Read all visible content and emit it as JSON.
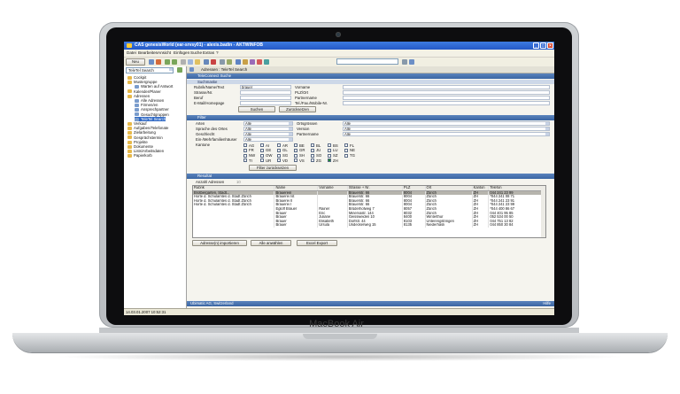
{
  "laptop": {
    "brand": "MacBook Air"
  },
  "window": {
    "title": "CAS genesisWorld (ear-srvsy01) - alexis.badin - AKTWINFOB"
  },
  "menu": [
    "Datei",
    "Bearbeiten",
    "Ansicht",
    "Einfügen",
    "Suche",
    "Extras",
    "?"
  ],
  "toolbar": {
    "new_label": "Neu"
  },
  "left_panel": {
    "view_select": "TeleTel Search",
    "tree": [
      {
        "label": "Cockpit",
        "level": 0
      },
      {
        "label": "Mustergruppe",
        "level": 0
      },
      {
        "label": "Warten auf Antwort",
        "level": 1
      },
      {
        "label": "Kalender/Planer",
        "level": 0
      },
      {
        "label": "Adressen",
        "level": 0
      },
      {
        "label": "Alle Adressen",
        "level": 1
      },
      {
        "label": "Firmen/en",
        "level": 1
      },
      {
        "label": "Ansprechpartner",
        "level": 1
      },
      {
        "label": "Gesuchtgruppen",
        "level": 1
      },
      {
        "label": "TeleTel Search",
        "level": 1
      },
      {
        "label": "Verkauf",
        "level": 0
      },
      {
        "label": "Aufgaben/Telefonate",
        "level": 0
      },
      {
        "label": "Zielarbeitung",
        "level": 0
      },
      {
        "label": "Gesprächstermin",
        "level": 0
      },
      {
        "label": "Projekte",
        "level": 0
      },
      {
        "label": "Dokumente",
        "level": 0
      },
      {
        "label": "Lists/Arbeitsdaten",
        "level": 0
      },
      {
        "label": "Papierkorb",
        "level": 0
      }
    ]
  },
  "main": {
    "tab_title": "Adressen : TeleTel Search",
    "search_section": "TeleConnect Suche",
    "suchmaske": "Suchmaske",
    "fields_left": [
      {
        "label": "Rubrik/Name/Text",
        "value": "brauer"
      },
      {
        "label": "Strasse/Nr.",
        "value": ""
      },
      {
        "label": "Beruf",
        "value": ""
      },
      {
        "label": "E-Mail/Homepage",
        "value": ""
      }
    ],
    "fields_right": [
      {
        "label": "Vorname",
        "value": ""
      },
      {
        "label": "PLZ/Ort",
        "value": ""
      },
      {
        "label": "Partnername",
        "value": ""
      },
      {
        "label": "Tel./Fax./Mobile-Nr.",
        "value": ""
      }
    ],
    "search_button": "Suchen",
    "reset_button": "Zurücksetzen",
    "filter_section": "Filter",
    "filters_left": [
      {
        "label": "Arten",
        "value": "Alle"
      },
      {
        "label": "Sprache des Ortes",
        "value": "Alle"
      },
      {
        "label": "Geschlecht",
        "value": "Alle"
      },
      {
        "label": "Ein-/Mehrfamilienhäuser",
        "value": "Alle"
      }
    ],
    "filters_right": [
      {
        "label": "Ortsgrössen",
        "value": "Alle"
      },
      {
        "label": "Version",
        "value": "Alle"
      },
      {
        "label": "Partnername",
        "value": "Alle"
      }
    ],
    "kantone_label": "Kantone",
    "kantone": [
      [
        "AG",
        "AI",
        "AR",
        "BE",
        "BL",
        "BS",
        "FL"
      ],
      [
        "FR",
        "GE",
        "GL",
        "GR",
        "JU",
        "LU",
        "NE"
      ],
      [
        "NW",
        "OW",
        "SG",
        "SH",
        "SO",
        "SZ",
        "TG"
      ],
      [
        "TI",
        "UR",
        "VD",
        "VS",
        "ZG",
        "ZH",
        ""
      ]
    ],
    "kantone_checked": [
      "ZH"
    ],
    "filter_reset_button": "Filter zurücksetzen",
    "result_section": "Resultat",
    "result_count_label": "Anzahl Adressen",
    "result_count": "10",
    "columns": [
      "Rubrik",
      "Name",
      "Vorname",
      "Strasse + Nr.",
      "PLZ",
      "Ort",
      "Kanton",
      "Telefon"
    ],
    "rows": [
      [
        "Brotbergarten, Stadt...",
        "Brauerein",
        "",
        "Brauerstr. 66",
        "8004",
        "Zürich",
        "ZH",
        "044 241 23 99"
      ],
      [
        "Horte d. Schulamtes d. Stadt Zürich",
        "Brauerei Ist",
        "",
        "Brauerstr. 66",
        "8004",
        "Zürich",
        "ZH",
        "*044 241 08 71"
      ],
      [
        "Horte d. Schulamtes d. Stadt Zürich",
        "Brauerei II",
        "",
        "Brauerstr. 66",
        "8004",
        "Zürich",
        "ZH",
        "*044 241 23 91"
      ],
      [
        "Horte d. Schulamtes d. Stadt Zürich",
        "Brauerei I",
        "",
        "Brauerstr. 66",
        "8004",
        "Zürich",
        "ZH",
        "*044 241 23 99"
      ],
      [
        "",
        "Egloff Brauer",
        "Rainer",
        "Brüderhofweg 7",
        "8057",
        "Zürich",
        "ZH",
        "*044 400 86 67"
      ],
      [
        "",
        "Brauer",
        "Eric",
        "Minervastr. 144",
        "8032",
        "Zürich",
        "ZH",
        "044 401 95 85"
      ],
      [
        "",
        "Brauer",
        "Juliane",
        "Geissweiden 10",
        "8400",
        "Winterthur",
        "ZH",
        "052 534 00 50"
      ],
      [
        "",
        "Brauer",
        "Elisabeth",
        "Dorfstr. 44",
        "8103",
        "Unterengstringen",
        "ZH",
        "044 751 13 82"
      ],
      [
        "",
        "Brauer",
        "Ursula",
        "Undeckerweg 15",
        "8135",
        "Niederhasli",
        "ZH",
        "044 850 30 84"
      ]
    ],
    "import_button": "Adresse(n) importieren",
    "select_all_button": "Alle anwählen",
    "excel_button": "Excel Export",
    "footer_left": "Ubimatic AG, Switzerland",
    "footer_right": "Hilfe"
  },
  "status": {
    "datetime": "14.03.01.2007 10:52:31"
  },
  "colors": {
    "titlebar": "#2459c7",
    "section": "#3a65a3",
    "selected": "#316ac5"
  }
}
